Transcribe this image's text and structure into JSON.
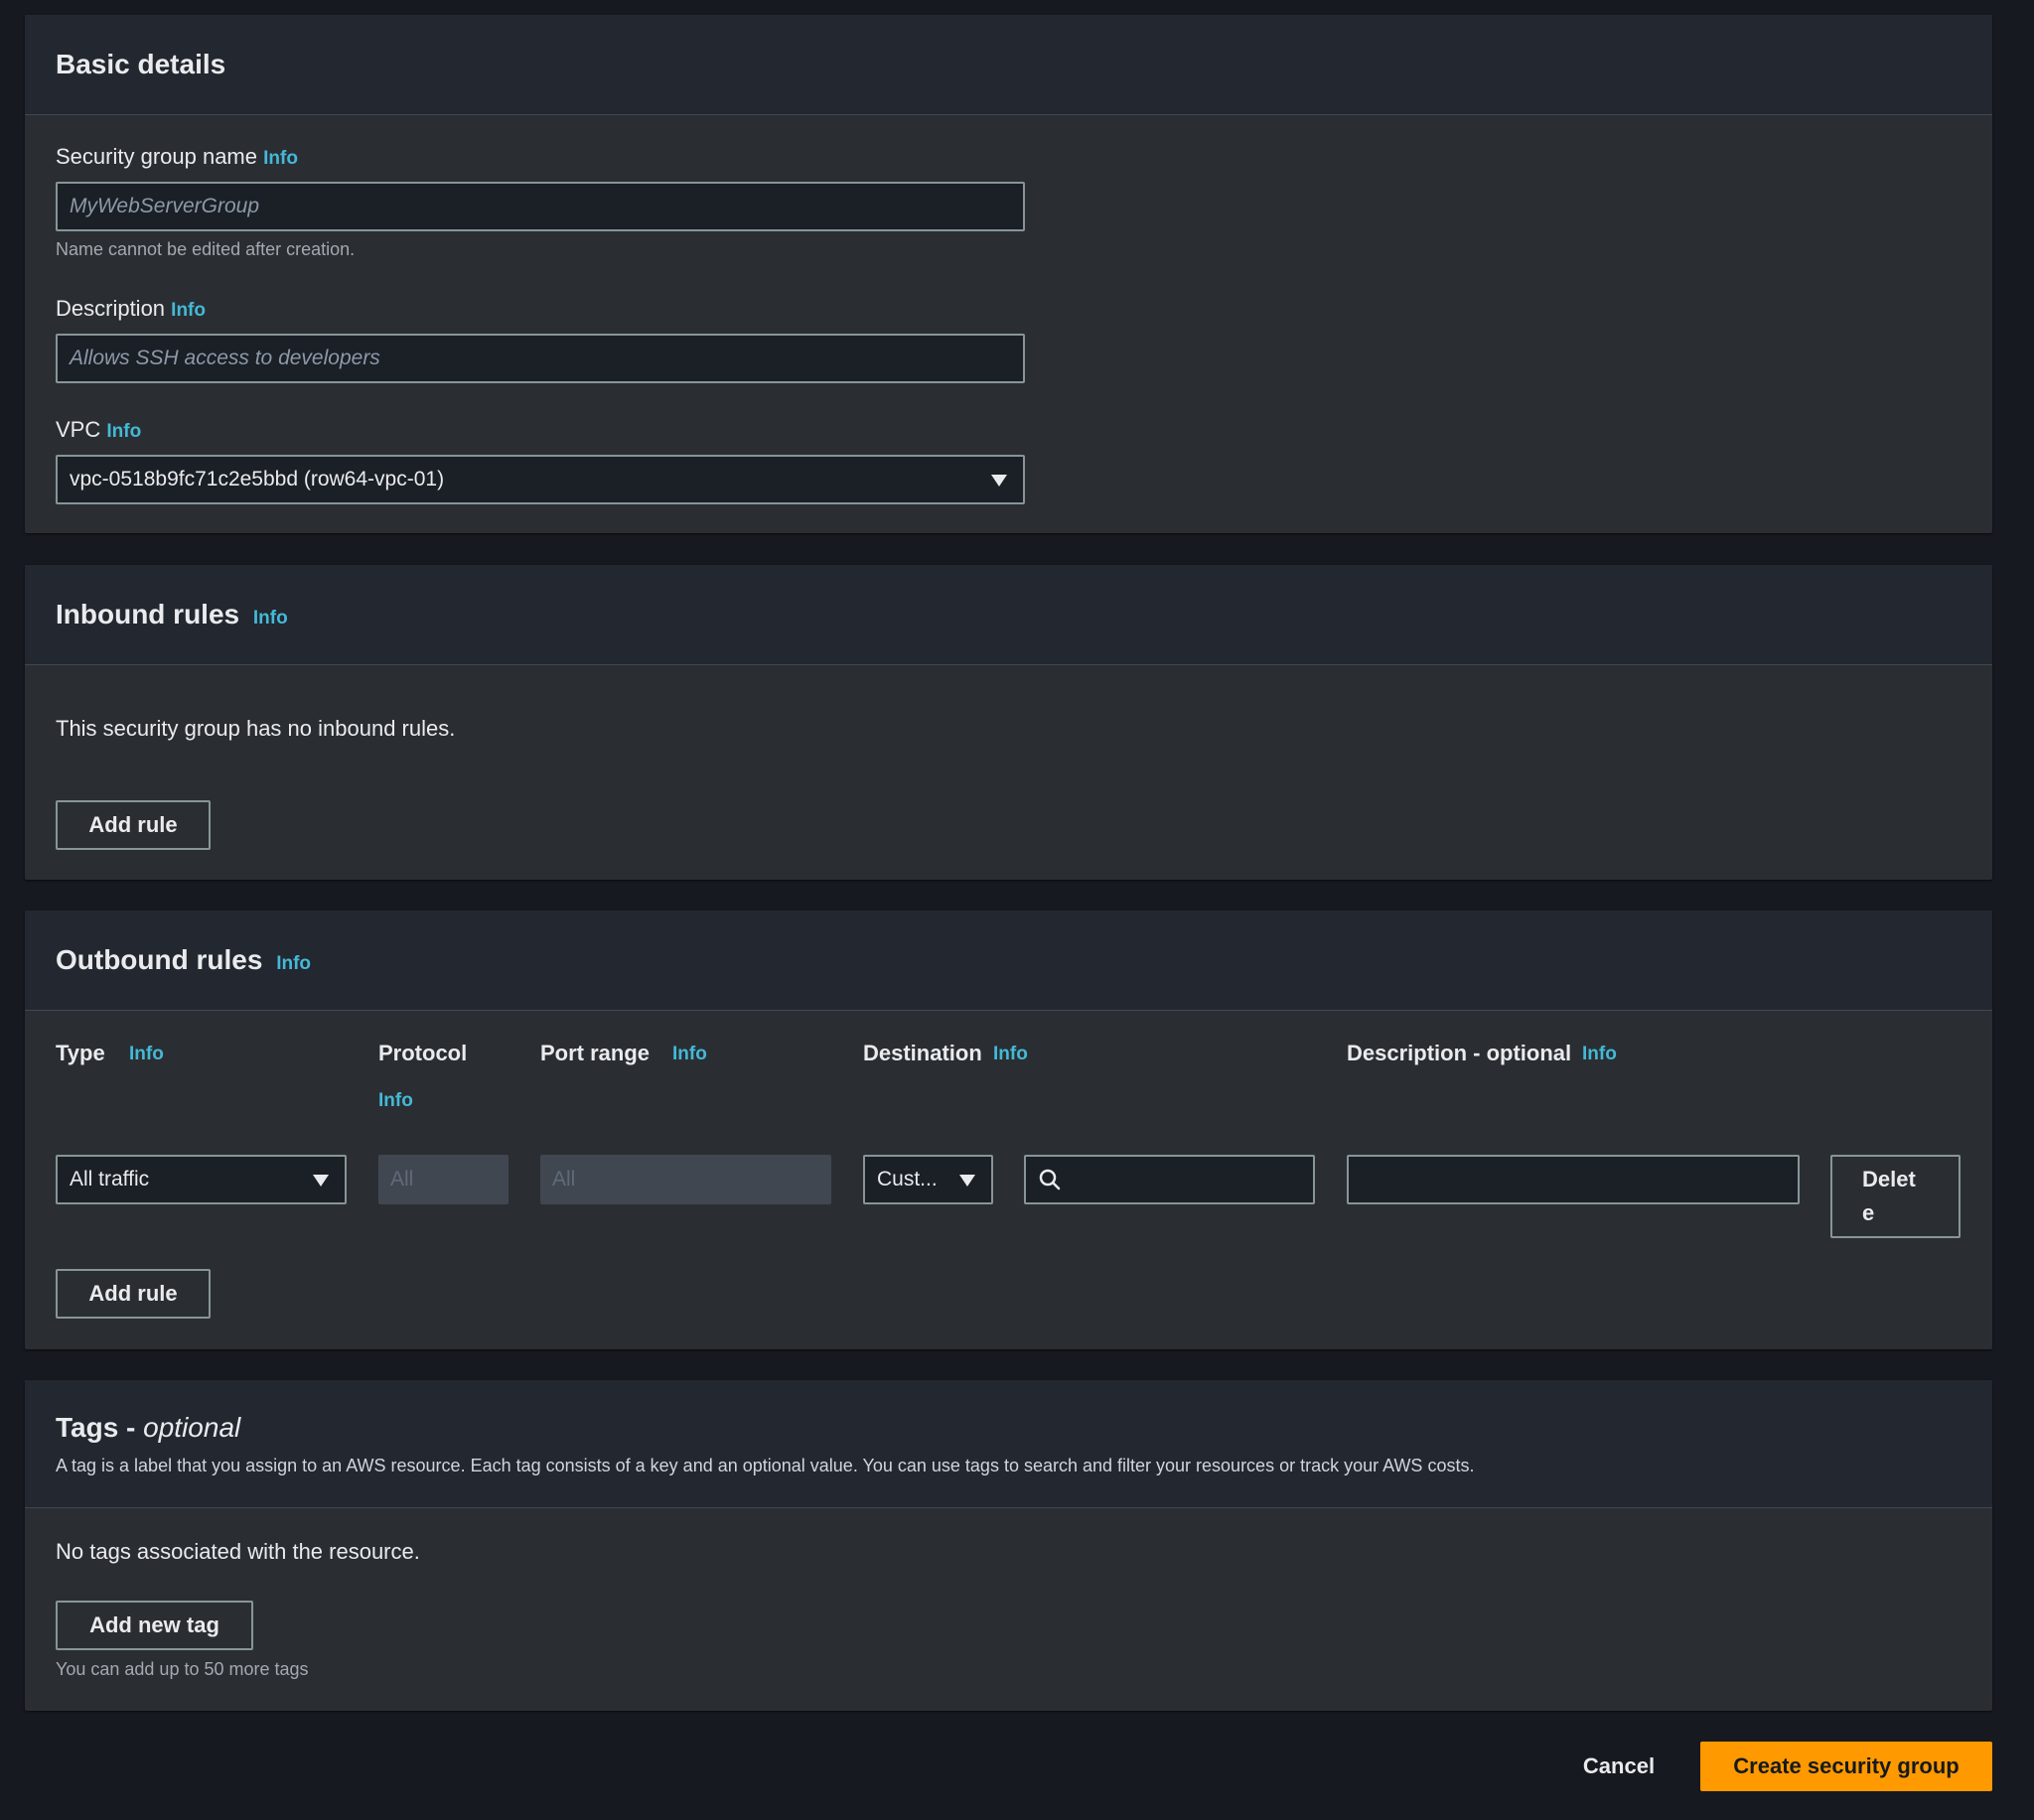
{
  "basic_details": {
    "title": "Basic details",
    "name_label": "Security group name",
    "name_info": "Info",
    "name_placeholder": "MyWebServerGroup",
    "name_hint": "Name cannot be edited after creation.",
    "desc_label": "Description",
    "desc_info": "Info",
    "desc_placeholder": "Allows SSH access to developers",
    "vpc_label": "VPC",
    "vpc_info": "Info",
    "vpc_value": "vpc-0518b9fc71c2e5bbd (row64-vpc-01)"
  },
  "inbound": {
    "title": "Inbound rules",
    "info": "Info",
    "empty_text": "This security group has no inbound rules.",
    "add_rule": "Add rule"
  },
  "outbound": {
    "title": "Outbound rules",
    "info": "Info",
    "columns": {
      "type": "Type",
      "type_info": "Info",
      "protocol": "Protocol",
      "protocol_info": "Info",
      "port_range": "Port range",
      "port_info": "Info",
      "destination": "Destination",
      "destination_info": "Info",
      "description": "Description - optional",
      "description_info": "Info"
    },
    "row": {
      "type": "All traffic",
      "protocol": "All",
      "port_range": "All",
      "destination_type": "Cust...",
      "destination_value": "",
      "description": "",
      "delete_line1": "Delet",
      "delete_line2": "e"
    },
    "add_rule": "Add rule"
  },
  "tags": {
    "title": "Tags - ",
    "title_optional": "optional",
    "description": "A tag is a label that you assign to an AWS resource. Each tag consists of a key and an optional value. You can use tags to search and filter your resources or track your AWS costs.",
    "empty_text": "No tags associated with the resource.",
    "add_tag": "Add new tag",
    "limit_hint": "You can add up to 50 more tags"
  },
  "footer": {
    "cancel": "Cancel",
    "create": "Create security group"
  },
  "colors": {
    "background": "#16191f",
    "panel": "#2a2e33",
    "accent_info": "#44b9d6",
    "primary_button": "#ff9900"
  },
  "icons": {
    "dropdown": "caret-down-icon",
    "search": "search-icon"
  }
}
